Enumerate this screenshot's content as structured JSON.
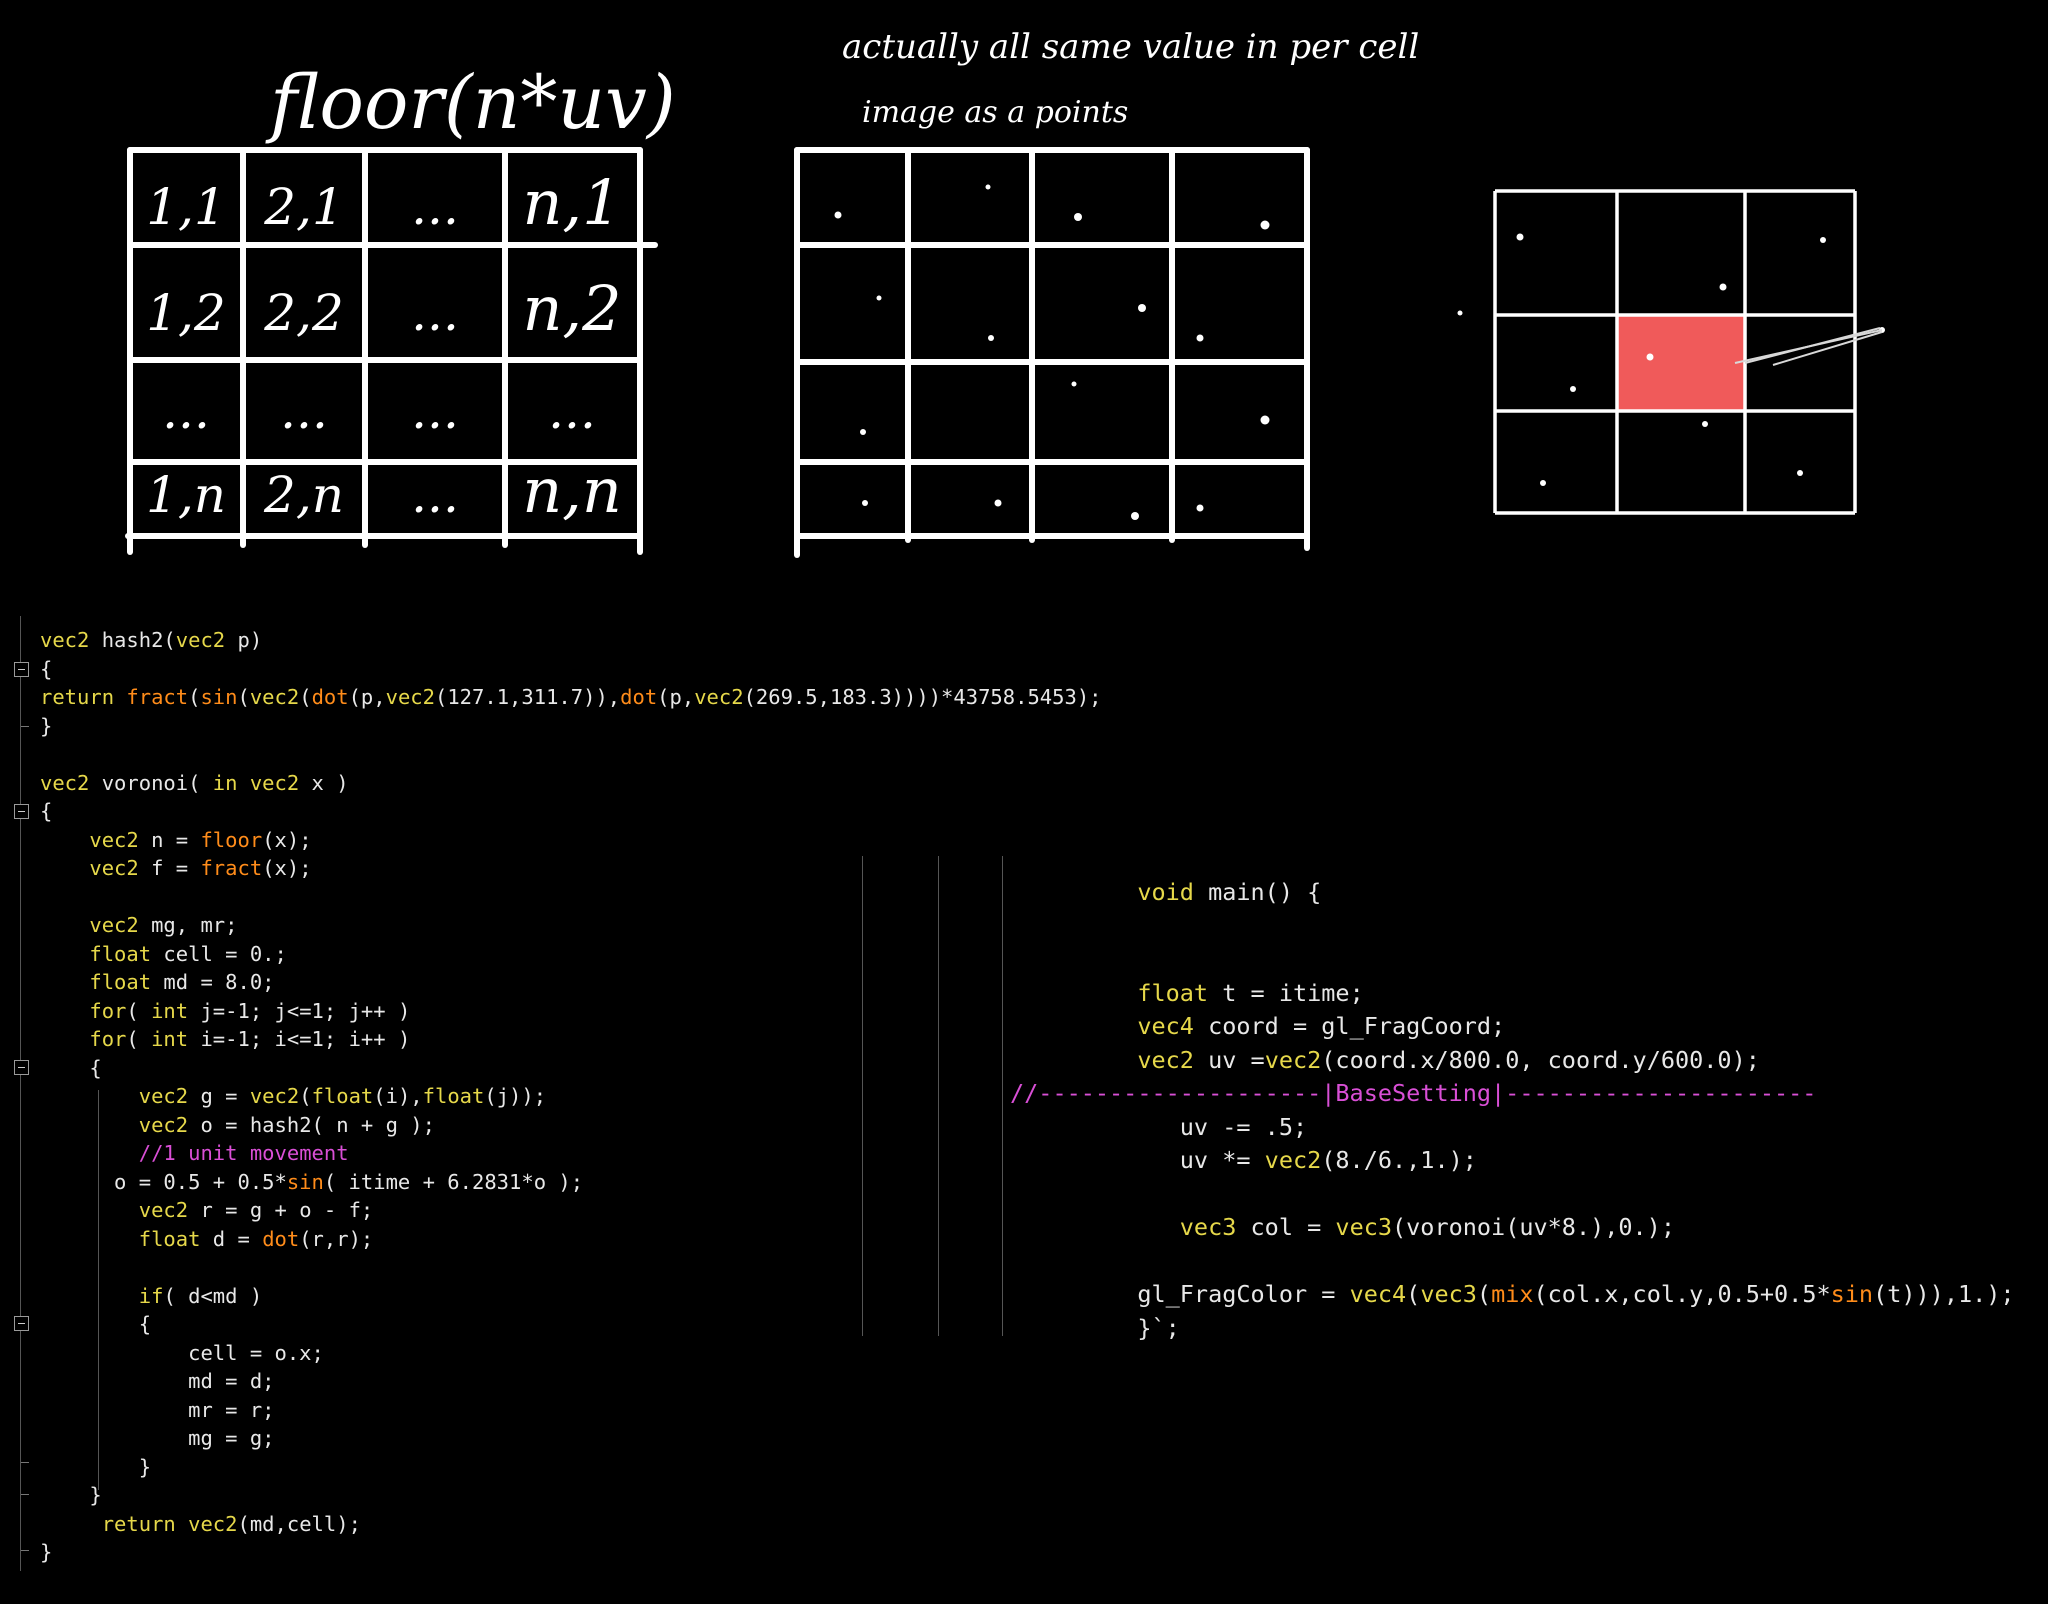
{
  "sketch": {
    "left_title": "floor(n*uv)",
    "left_cells": [
      [
        "1,1",
        "2,1",
        "...",
        "n,1"
      ],
      [
        "1,2",
        "2,2",
        "...",
        "n,2"
      ],
      [
        "...",
        "...",
        "...",
        "..."
      ],
      [
        "1,n",
        "2,n",
        "...",
        "n,n"
      ]
    ],
    "middle_note_1": "actually all same value in per cell",
    "middle_note_2": "image as a points",
    "right_highlight_color": "#f05a5a"
  },
  "code_left": {
    "lines": [
      "vec2 hash2(vec2 p)",
      "{",
      "return fract(sin(vec2(dot(p,vec2(127.1,311.7)),dot(p,vec2(269.5,183.3))))*43758.5453);",
      "}",
      "",
      "vec2 voronoi( in vec2 x )",
      "{",
      "    vec2 n = floor(x);",
      "    vec2 f = fract(x);",
      "",
      "    vec2 mg, mr;",
      "    float cell = 0.;",
      "    float md = 8.0;",
      "    for( int j=-1; j<=1; j++ )",
      "    for( int i=-1; i<=1; i++ )",
      "    {",
      "        vec2 g = vec2(float(i),float(j));",
      "        vec2 o = hash2( n + g );",
      "        //1 unit movement",
      "      o = 0.5 + 0.5*sin( itime + 6.2831*o );",
      "        vec2 r = g + o - f;",
      "        float d = dot(r,r);",
      "",
      "        if( d<md )",
      "        {",
      "            cell = o.x;",
      "            md = d;",
      "            mr = r;",
      "            mg = g;",
      "        }",
      "    }",
      "     return vec2(md,cell);",
      "}"
    ]
  },
  "code_right": {
    "lines": [
      "         void main() {",
      "",
      "",
      "         float t = itime;",
      "         vec4 coord = gl_FragCoord;",
      "         vec2 uv =vec2(coord.x/800.0, coord.y/600.0);",
      "//--------------------|BaseSetting|----------------------",
      "            uv -= .5;",
      "            uv *= vec2(8./6.,1.);",
      "",
      "            vec3 col = vec3(voronoi(uv*8.),0.);",
      "",
      "         gl_FragColor = vec4(vec3(mix(col.x,col.y,0.5+0.5*sin(t))),1.);",
      "         }`;"
    ]
  },
  "colors": {
    "background": "#000000",
    "text": "#e8e8e8",
    "keyword": "#e6d84a",
    "function": "#ff8c1a",
    "comment": "#d94fd6"
  }
}
